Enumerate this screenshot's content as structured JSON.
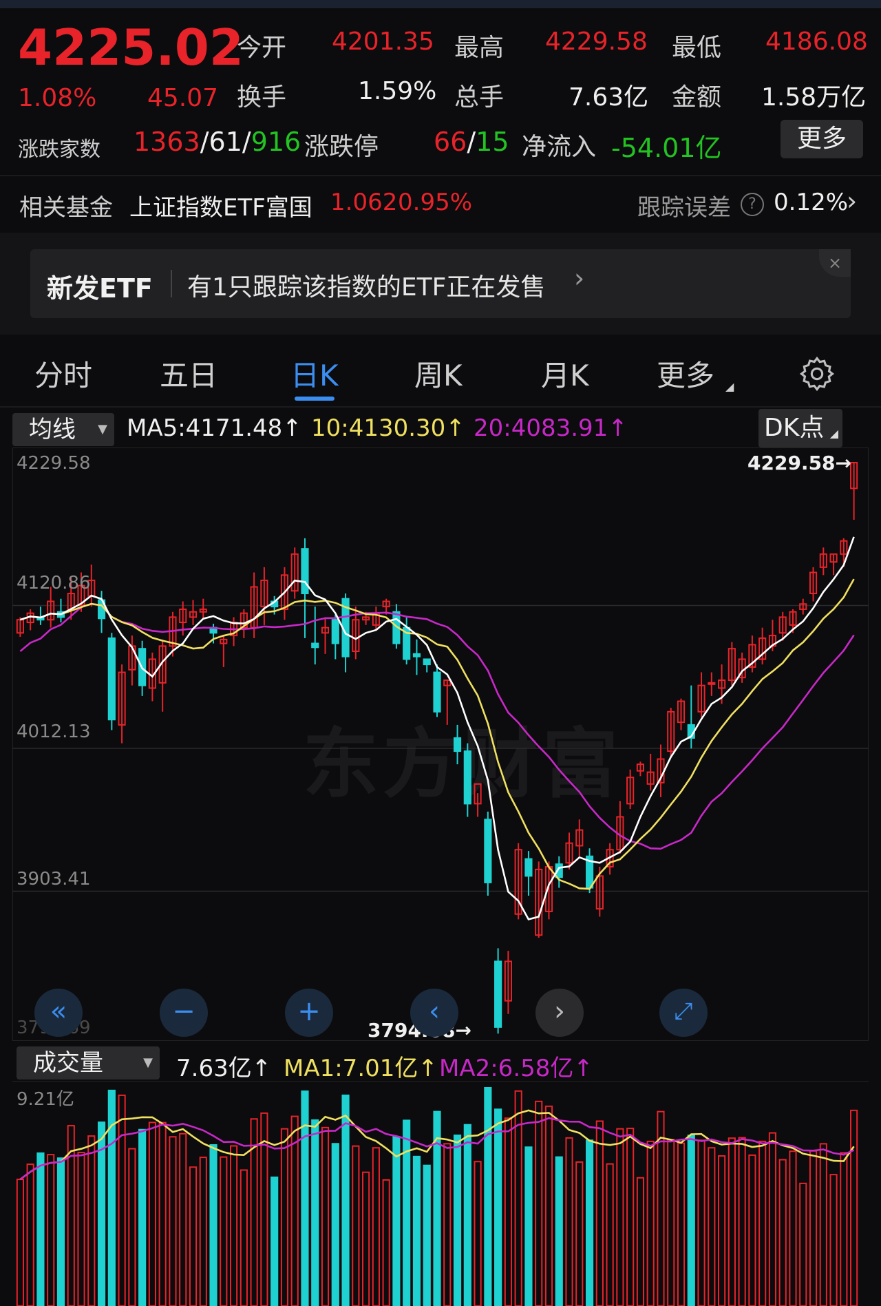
{
  "quote": {
    "price": "4225.02",
    "change_pct": "1.08%",
    "change": "45.07",
    "open_label": "今开",
    "open": "4201.35",
    "high_label": "最高",
    "high": "4229.58",
    "low_label": "最低",
    "low": "4186.08",
    "turnover_label": "换手",
    "turnover": "1.59%",
    "volume_label": "总手",
    "volume": "7.63亿",
    "amount_label": "金额",
    "amount": "1.58万亿",
    "breadth_label": "涨跌家数",
    "breadth_up": "1363",
    "breadth_flat": "61",
    "breadth_down": "916",
    "limit_label": "涨跌停",
    "limit_up": "66",
    "limit_down": "15",
    "netflow_label": "净流入",
    "netflow": "-54.01亿",
    "more_label": "更多",
    "slash": "/"
  },
  "fund": {
    "label": "相关基金",
    "name": "上证指数ETF富国",
    "price": "1.062",
    "change": "0.95%",
    "tracking_label": "跟踪误差",
    "tracking_value": "0.12%"
  },
  "banner": {
    "tag": "新发ETF",
    "text": "有1只跟踪该指数的ETF正在发售",
    "close": "×"
  },
  "tabs": [
    "分时",
    "五日",
    "日K",
    "周K",
    "月K",
    "更多"
  ],
  "active_tab": "日K",
  "ma_bar": {
    "select": "均线",
    "ma5": "MA5:4171.48↑",
    "ma10": "10:4130.30↑",
    "ma20": "20:4083.91↑",
    "dk": "DK点"
  },
  "vol_bar": {
    "select": "成交量",
    "vol": "7.63亿↑",
    "ma1": "MA1:7.01亿↑",
    "ma2": "MA2:6.58亿↑"
  },
  "watermark": "东方财富",
  "colors": {
    "up": "#e8232a",
    "down": "#1fd1d1",
    "ma5": "#ffffff",
    "ma10": "#f0e060",
    "ma20": "#c828c8",
    "accent": "#3b8ef0"
  },
  "chart_data": {
    "type": "candlestick",
    "y_ticks": [
      "4229.58",
      "4120.86",
      "4012.13",
      "3903.41",
      "3794.69"
    ],
    "ylim": [
      3794.68,
      4229.58
    ],
    "max_marker": "4229.58→",
    "min_marker": "3794.68→",
    "candles": [
      [
        4100,
        4110,
        4097,
        4112
      ],
      [
        4108,
        4115,
        4102,
        4118
      ],
      [
        4112,
        4110,
        4106,
        4120
      ],
      [
        4110,
        4124,
        4104,
        4135
      ],
      [
        4116,
        4112,
        4108,
        4126
      ],
      [
        4118,
        4130,
        4110,
        4142
      ],
      [
        4121,
        4136,
        4116,
        4146
      ],
      [
        4128,
        4140,
        4120,
        4152
      ],
      [
        4125,
        4111,
        4100,
        4132
      ],
      [
        4096,
        4034,
        4026,
        4100
      ],
      [
        4030,
        4070,
        4016,
        4076
      ],
      [
        4072,
        4090,
        4060,
        4098
      ],
      [
        4088,
        4060,
        4052,
        4094
      ],
      [
        4058,
        4080,
        4048,
        4085
      ],
      [
        4062,
        4090,
        4040,
        4095
      ],
      [
        4090,
        4112,
        4082,
        4116
      ],
      [
        4108,
        4118,
        4098,
        4124
      ],
      [
        4112,
        4116,
        4106,
        4125
      ],
      [
        4116,
        4118,
        4110,
        4126
      ],
      [
        4104,
        4100,
        4092,
        4107
      ],
      [
        4092,
        4095,
        4074,
        4098
      ],
      [
        4098,
        4108,
        4090,
        4112
      ],
      [
        4104,
        4115,
        4096,
        4118
      ],
      [
        4104,
        4135,
        4096,
        4146
      ],
      [
        4120,
        4140,
        4106,
        4150
      ],
      [
        4124,
        4120,
        4114,
        4128
      ],
      [
        4118,
        4144,
        4110,
        4150
      ],
      [
        4132,
        4160,
        4126,
        4165
      ],
      [
        4164,
        4130,
        4096,
        4172
      ],
      [
        4092,
        4089,
        4076,
        4120
      ],
      [
        4100,
        4104,
        4084,
        4112
      ],
      [
        4110,
        4092,
        4080,
        4114
      ],
      [
        4126,
        4082,
        4070,
        4130
      ],
      [
        4086,
        4110,
        4080,
        4120
      ],
      [
        4110,
        4112,
        4106,
        4116
      ],
      [
        4106,
        4115,
        4102,
        4120
      ],
      [
        4120,
        4124,
        4114,
        4126
      ],
      [
        4116,
        4092,
        4088,
        4122
      ],
      [
        4104,
        4080,
        4076,
        4112
      ],
      [
        4084,
        4082,
        4068,
        4095
      ],
      [
        4080,
        4076,
        4070,
        4080
      ],
      [
        4070,
        4040,
        4036,
        4076
      ],
      [
        4060,
        4064,
        4030,
        4064
      ],
      [
        4020,
        4010,
        4000,
        4030
      ],
      [
        4010,
        3970,
        3960,
        4016
      ],
      [
        3970,
        3985,
        3960,
        3978
      ],
      [
        3958,
        3910,
        3900,
        3964
      ],
      [
        3850,
        3800,
        3795,
        3860
      ],
      [
        3820,
        3850,
        3810,
        3858
      ],
      [
        3886,
        3935,
        3882,
        3940
      ],
      [
        3928,
        3915,
        3900,
        3934
      ],
      [
        3870,
        3920,
        3868,
        3926
      ],
      [
        3888,
        3922,
        3882,
        3926
      ],
      [
        3924,
        3914,
        3906,
        3930
      ],
      [
        3925,
        3940,
        3920,
        3948
      ],
      [
        3938,
        3950,
        3930,
        3958
      ],
      [
        3930,
        3906,
        3902,
        3936
      ],
      [
        3890,
        3915,
        3884,
        3922
      ],
      [
        3922,
        3935,
        3916,
        3940
      ],
      [
        3935,
        3960,
        3932,
        3972
      ],
      [
        3970,
        3990,
        3966,
        3996
      ],
      [
        3995,
        4000,
        3991,
        4002
      ],
      [
        3985,
        3994,
        3980,
        4008
      ],
      [
        3986,
        4004,
        3975,
        4015
      ],
      [
        4010,
        4040,
        4006,
        4043
      ],
      [
        4032,
        4048,
        4026,
        4050
      ],
      [
        4030,
        4020,
        4012,
        4060
      ],
      [
        4040,
        4060,
        4036,
        4070
      ],
      [
        4062,
        4062,
        4052,
        4070
      ],
      [
        4058,
        4064,
        4046,
        4076
      ],
      [
        4064,
        4088,
        4060,
        4093
      ],
      [
        4066,
        4080,
        4062,
        4085
      ],
      [
        4074,
        4091,
        4070,
        4098
      ],
      [
        4080,
        4096,
        4076,
        4104
      ],
      [
        4090,
        4098,
        4086,
        4110
      ],
      [
        4100,
        4112,
        4094,
        4116
      ],
      [
        4106,
        4116,
        4100,
        4118
      ],
      [
        4118,
        4122,
        4114,
        4126
      ],
      [
        4130,
        4146,
        4124,
        4150
      ],
      [
        4150,
        4160,
        4144,
        4165
      ],
      [
        4154,
        4160,
        4144,
        4160
      ],
      [
        4160,
        4170,
        4150,
        4172
      ],
      [
        4210,
        4229.58,
        4186.08,
        4229.58
      ]
    ]
  }
}
